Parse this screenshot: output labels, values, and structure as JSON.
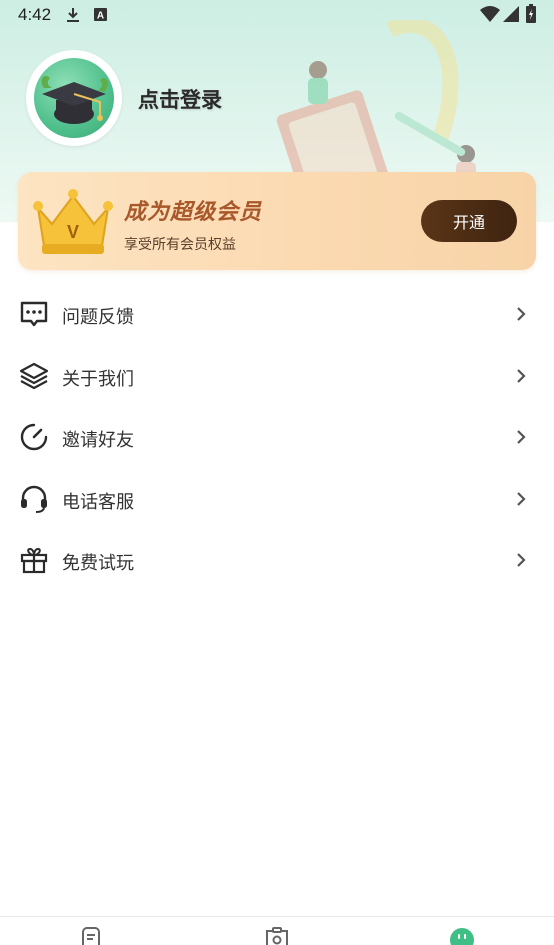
{
  "status_bar": {
    "time": "4:42",
    "icons": [
      "download-icon",
      "keyboard-a-icon",
      "wifi-icon",
      "signal-icon",
      "battery-icon"
    ]
  },
  "profile": {
    "login_text": "点击登录",
    "avatar_icon": "graduation-cap-icon"
  },
  "vip": {
    "title": "成为超级会员",
    "subtitle": "享受所有会员权益",
    "button_label": "开通",
    "crown_badge": "V",
    "accent": "#a8582a",
    "button_color": "#4a2a12"
  },
  "menu": {
    "items": [
      {
        "label": "问题反馈",
        "icon": "feedback-chat-icon"
      },
      {
        "label": "关于我们",
        "icon": "layers-icon"
      },
      {
        "label": "邀请好友",
        "icon": "timer-icon"
      },
      {
        "label": "电话客服",
        "icon": "headset-icon"
      },
      {
        "label": "免费试玩",
        "icon": "gift-icon"
      }
    ]
  },
  "bottom_nav": {
    "icons": [
      "document-icon",
      "clipboard-icon",
      "profile-face-icon"
    ],
    "active_color": "#3fbf86"
  }
}
